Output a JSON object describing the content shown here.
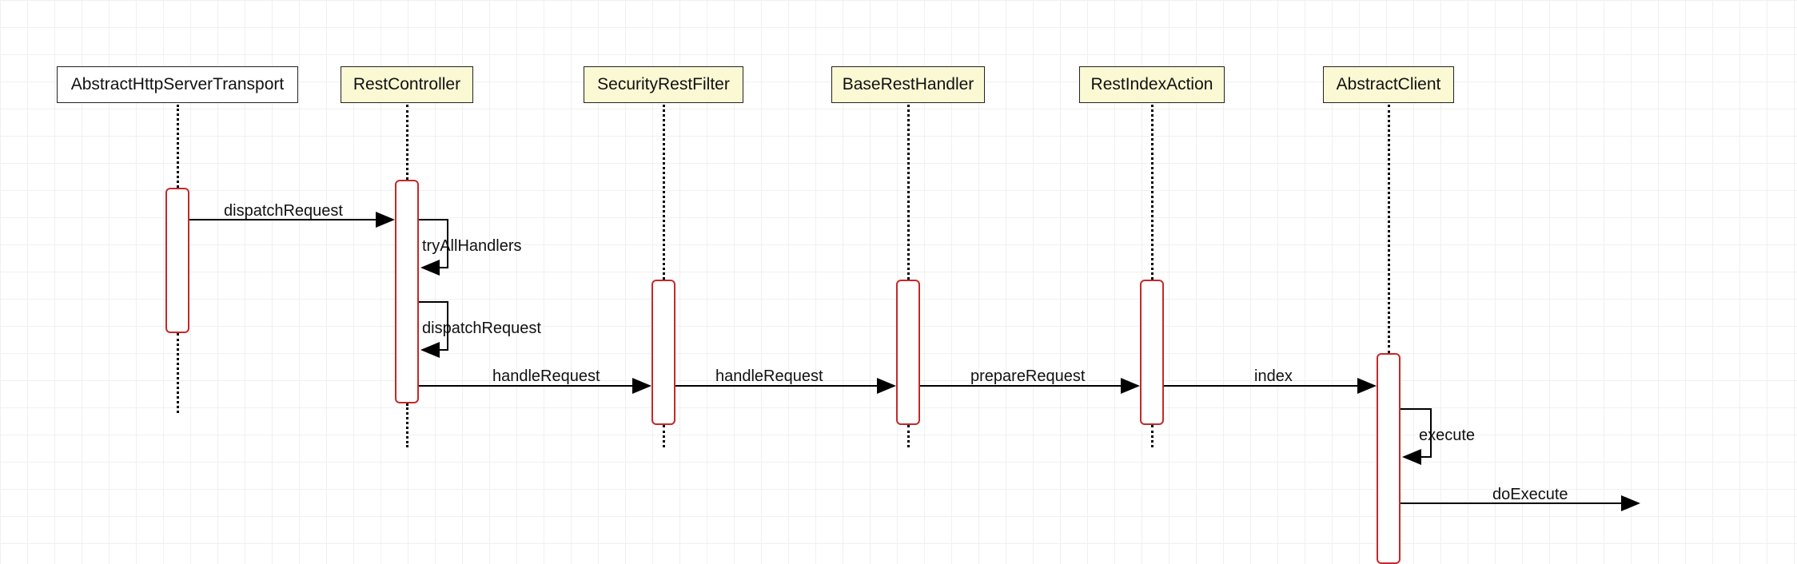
{
  "participants": {
    "p0": {
      "label": "AbstractHttpServerTransport"
    },
    "p1": {
      "label": "RestController"
    },
    "p2": {
      "label": "SecurityRestFilter"
    },
    "p3": {
      "label": "BaseRestHandler"
    },
    "p4": {
      "label": "RestIndexAction"
    },
    "p5": {
      "label": "AbstractClient"
    }
  },
  "messages": {
    "m0": "dispatchRequest",
    "m1": "tryAllHandlers",
    "m2": "dispatchRequest",
    "m3": "handleRequest",
    "m4": "handleRequest",
    "m5": "prepareRequest",
    "m6": "index",
    "m7": "execute",
    "m8": "doExecute"
  },
  "chart_data": {
    "type": "sequence-diagram",
    "participants": [
      "AbstractHttpServerTransport",
      "RestController",
      "SecurityRestFilter",
      "BaseRestHandler",
      "RestIndexAction",
      "AbstractClient"
    ],
    "messages": [
      {
        "from": "AbstractHttpServerTransport",
        "to": "RestController",
        "label": "dispatchRequest",
        "self": false
      },
      {
        "from": "RestController",
        "to": "RestController",
        "label": "tryAllHandlers",
        "self": true
      },
      {
        "from": "RestController",
        "to": "RestController",
        "label": "dispatchRequest",
        "self": true
      },
      {
        "from": "RestController",
        "to": "SecurityRestFilter",
        "label": "handleRequest",
        "self": false
      },
      {
        "from": "SecurityRestFilter",
        "to": "BaseRestHandler",
        "label": "handleRequest",
        "self": false
      },
      {
        "from": "BaseRestHandler",
        "to": "RestIndexAction",
        "label": "prepareRequest",
        "self": false
      },
      {
        "from": "RestIndexAction",
        "to": "AbstractClient",
        "label": "index",
        "self": false
      },
      {
        "from": "AbstractClient",
        "to": "AbstractClient",
        "label": "execute",
        "self": true
      },
      {
        "from": "AbstractClient",
        "to": "(external)",
        "label": "doExecute",
        "self": false
      }
    ]
  }
}
